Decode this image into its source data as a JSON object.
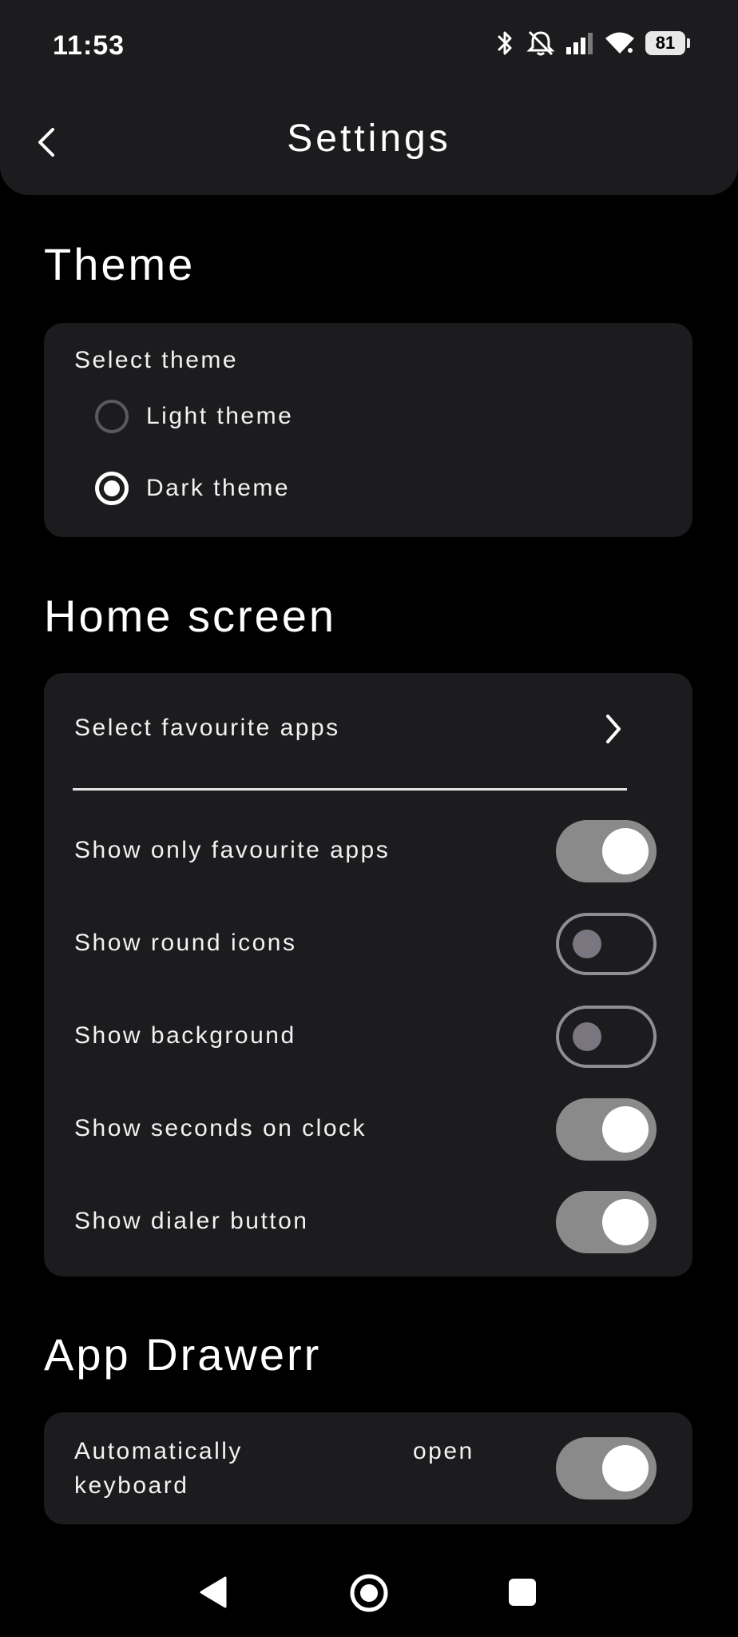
{
  "status": {
    "time": "11:53",
    "battery": "81"
  },
  "header": {
    "title": "Settings"
  },
  "theme": {
    "title": "Theme",
    "subtitle": "Select theme",
    "options": [
      {
        "label": "Light theme",
        "selected": false
      },
      {
        "label": "Dark theme",
        "selected": true
      }
    ]
  },
  "home": {
    "title": "Home screen",
    "favourite_link": "Select favourite apps",
    "toggles": [
      {
        "label": "Show only favourite apps",
        "on": true
      },
      {
        "label": "Show round icons",
        "on": false
      },
      {
        "label": "Show background",
        "on": false
      },
      {
        "label": "Show seconds on clock",
        "on": true
      },
      {
        "label": "Show dialer button",
        "on": true
      }
    ]
  },
  "drawer": {
    "title": "App Drawerr",
    "toggle": {
      "label_line1_left": "Automatically",
      "label_line1_right": "open",
      "label_line2": "keyboard",
      "on": true
    }
  },
  "colors": {
    "background": "#000000",
    "surface": "#1c1c1e",
    "toggle_on_track": "#8a8a8a",
    "toggle_off_knob": "#7a7680"
  },
  "icons": [
    "bluetooth-icon",
    "notifications-off-icon",
    "signal-icon",
    "wifi-icon",
    "battery-icon",
    "back-arrow-icon",
    "chevron-right-icon",
    "nav-back-icon",
    "nav-home-icon",
    "nav-recents-icon"
  ]
}
